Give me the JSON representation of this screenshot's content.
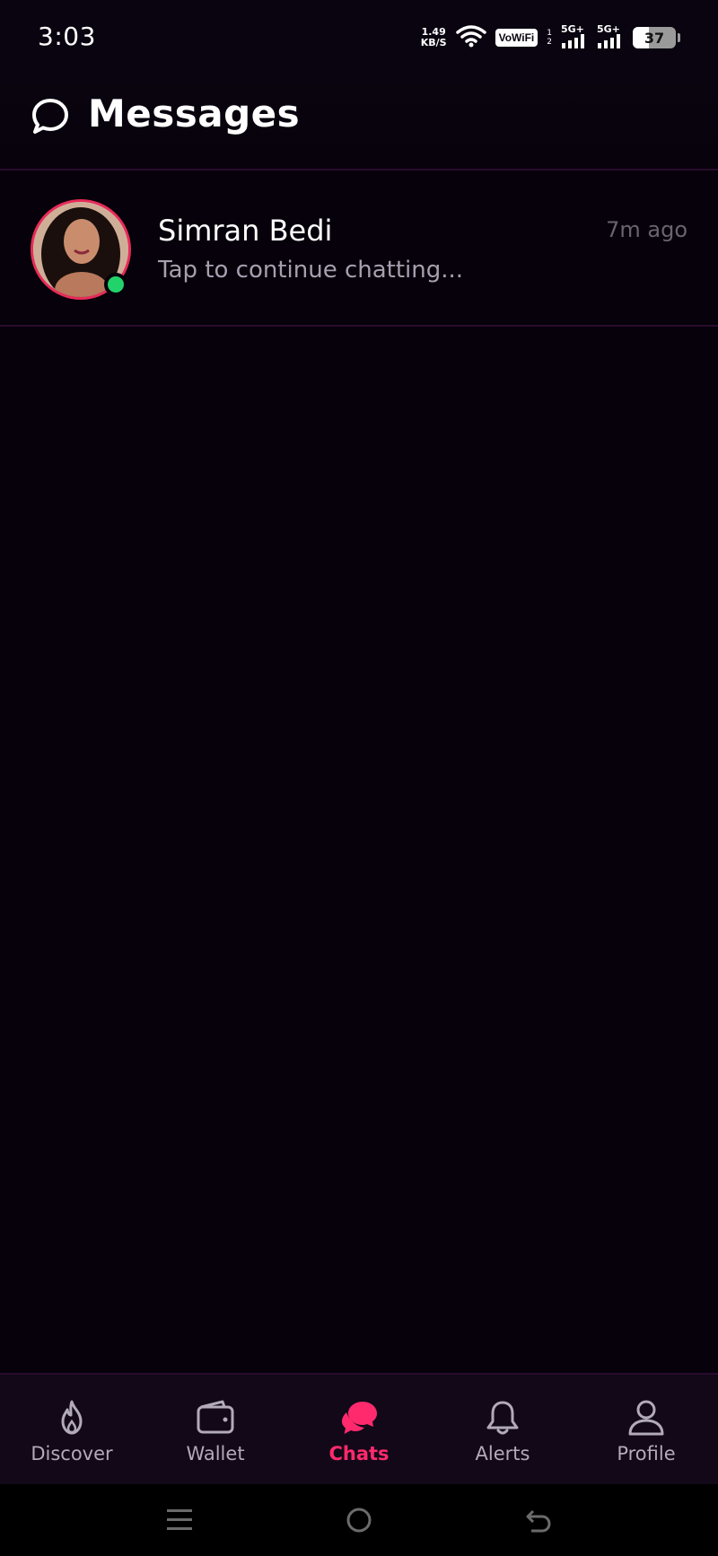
{
  "status_bar": {
    "time": "3:03",
    "net_speed_value": "1.49",
    "net_speed_unit": "KB/S",
    "vowifi_label": "VoWiFi",
    "sim_1": "1",
    "sim_2": "2",
    "signal_1_label": "5G+",
    "signal_2_label": "5G+",
    "battery_level": "37",
    "battery_fraction": 0.37
  },
  "header": {
    "title": "Messages",
    "icon": "chat-bubble-icon"
  },
  "chats": [
    {
      "name": "Simran Bedi",
      "preview": "Tap to continue chatting...",
      "time": "7m ago",
      "online": true
    }
  ],
  "bottom_nav": {
    "items": [
      {
        "label": "Discover",
        "icon": "flame-icon",
        "active": false
      },
      {
        "label": "Wallet",
        "icon": "wallet-icon",
        "active": false
      },
      {
        "label": "Chats",
        "icon": "chats-icon",
        "active": true
      },
      {
        "label": "Alerts",
        "icon": "bell-icon",
        "active": false
      },
      {
        "label": "Profile",
        "icon": "user-icon",
        "active": false
      }
    ]
  },
  "colors": {
    "background": "#06010a",
    "accent": "#ff2a6d",
    "online": "#22d36b",
    "divider": "#2a0c2e"
  },
  "system_nav": {
    "buttons": [
      "menu-icon",
      "home-icon",
      "back-icon"
    ]
  }
}
